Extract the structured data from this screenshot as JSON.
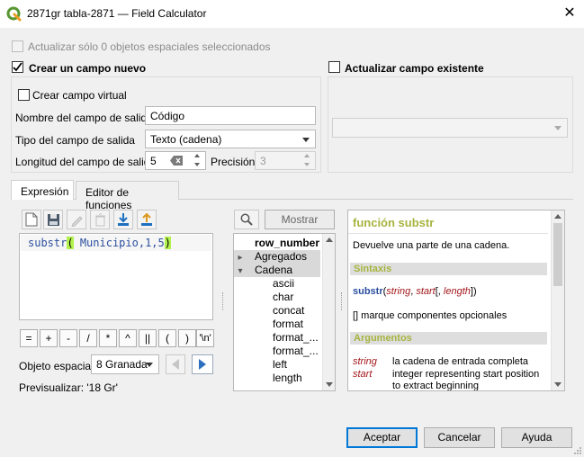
{
  "window": {
    "title": "2871gr tabla-2871 — Field Calculator",
    "close_glyph": "✕"
  },
  "top": {
    "update_selected_label": "Actualizar sólo 0 objetos espaciales seleccionados"
  },
  "create_new": {
    "label": "Crear un campo nuevo",
    "checked": true,
    "virtual_label": "Crear campo virtual",
    "name_label": "Nombre del campo de salida",
    "name_value": "Código",
    "type_label": "Tipo del campo de salida",
    "type_value": "Texto (cadena)",
    "length_label": "Longitud del campo de salida",
    "length_value": "5",
    "precision_label": "Precisión",
    "precision_value": "3"
  },
  "update_existing": {
    "label": "Actualizar campo existente",
    "checked": false
  },
  "tabs": [
    {
      "label": "Expresión",
      "active": true
    },
    {
      "label": "Editor de funciones",
      "active": false
    }
  ],
  "expression": {
    "text_fn": "substr",
    "text_open": "(",
    "text_args": " Municipio,1,5",
    "text_close": ")"
  },
  "operators": [
    "=",
    "+",
    "-",
    "/",
    "*",
    "^",
    "||",
    "(",
    ")",
    "'\\n'"
  ],
  "feature": {
    "label": "Objeto espacial",
    "value": "8 Granada",
    "preview_label": "Previsualizar:",
    "preview_value": "'18 Gr'"
  },
  "search": {
    "show_help_label": "Mostrar ayuda"
  },
  "function_tree": [
    {
      "label": "row_number",
      "bold": true,
      "indent": 0,
      "arrow": ""
    },
    {
      "label": "Agregados",
      "indent": 0,
      "arrow": "▸",
      "selected": true
    },
    {
      "label": "Cadena",
      "indent": 0,
      "arrow": "▾",
      "selected": true
    },
    {
      "label": "ascii",
      "indent": 1,
      "arrow": ""
    },
    {
      "label": "char",
      "indent": 1,
      "arrow": ""
    },
    {
      "label": "concat",
      "indent": 1,
      "arrow": ""
    },
    {
      "label": "format",
      "indent": 1,
      "arrow": ""
    },
    {
      "label": "format_...",
      "indent": 1,
      "arrow": ""
    },
    {
      "label": "format_...",
      "indent": 1,
      "arrow": ""
    },
    {
      "label": "left",
      "indent": 1,
      "arrow": ""
    },
    {
      "label": "length",
      "indent": 1,
      "arrow": ""
    }
  ],
  "help": {
    "title": "función substr",
    "description": "Devuelve una parte de una cadena.",
    "syntax_header": "Sintaxis",
    "syntax_fn": "substr",
    "syntax_args": [
      {
        "text": "(",
        "italic": false
      },
      {
        "text": "string",
        "italic": true
      },
      {
        "text": ", ",
        "italic": false
      },
      {
        "text": "start",
        "italic": true
      },
      {
        "text": "[, ",
        "italic": false
      },
      {
        "text": "length",
        "italic": true
      },
      {
        "text": "])",
        "italic": false
      }
    ],
    "optional_note": "[] marque componentes opcionales",
    "args_header": "Argumentos",
    "args": [
      {
        "name": "string",
        "desc": "la cadena de entrada completa"
      },
      {
        "name": "start",
        "desc": "integer representing start position to extract beginning"
      }
    ]
  },
  "buttons": {
    "accept": "Aceptar",
    "cancel": "Cancelar",
    "help": "Ayuda"
  },
  "colors": {
    "accent": "#0078d7",
    "help_green": "#a7b43e",
    "bracket_highlight": "#b2f24d",
    "expr_blue": "#2b4f9e"
  }
}
